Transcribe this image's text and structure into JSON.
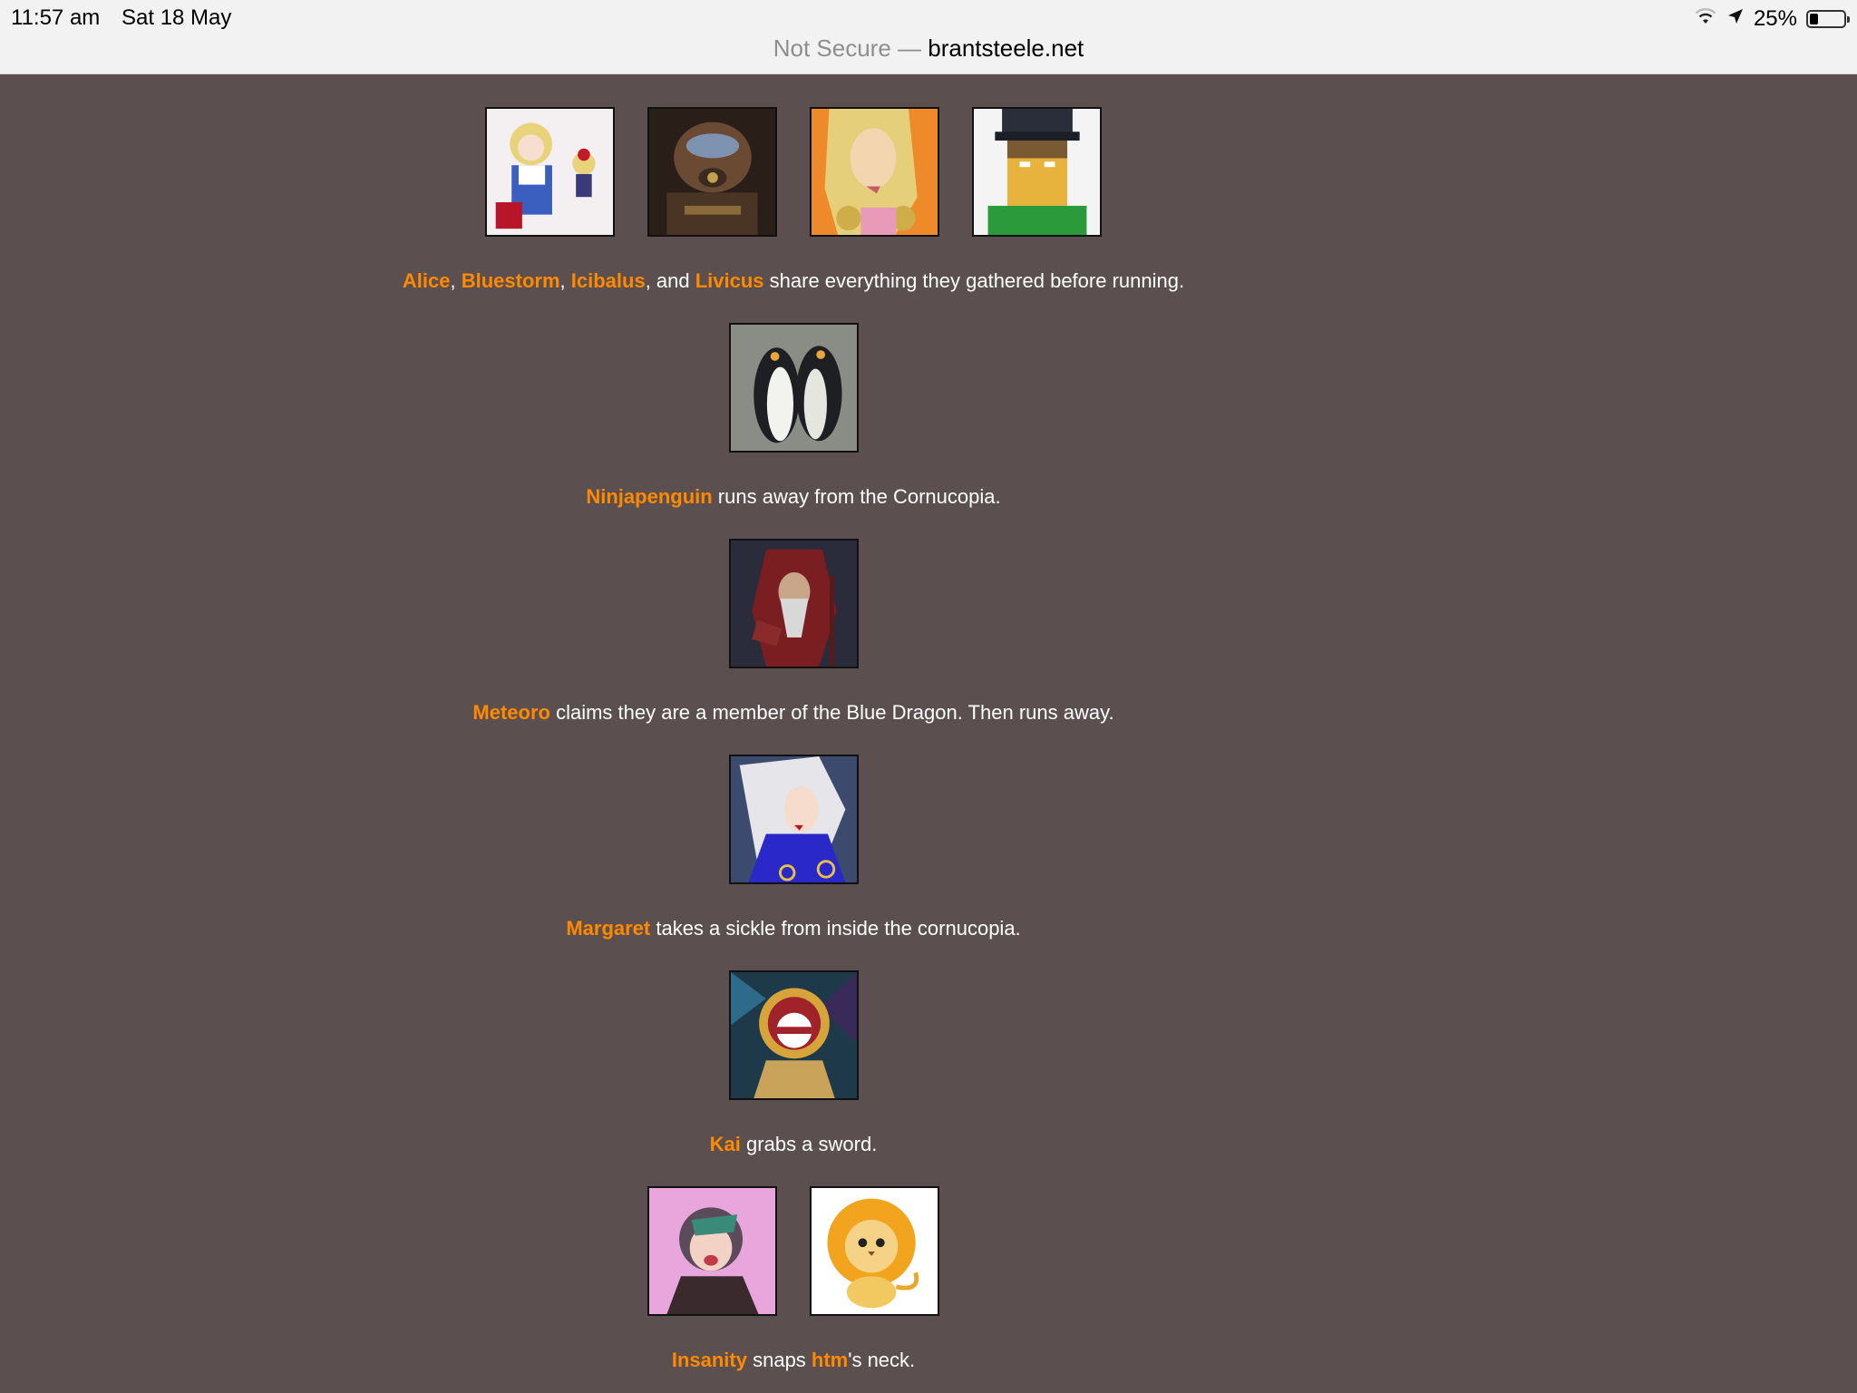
{
  "status_bar": {
    "time": "11:57 am",
    "date": "Sat 18 May",
    "battery_text": "25%",
    "battery_level": 0.25,
    "url_prefix": "Not Secure —",
    "url_host": "brantsteele.net"
  },
  "colors": {
    "background": "#5b4f50",
    "name_color": "#ff8a00",
    "text_color": "#ffffff"
  },
  "events": [
    {
      "tributes": [
        "Alice",
        "Bluestorm",
        "Icibalus",
        "Livicus"
      ],
      "segments": [
        {
          "text": "Alice",
          "name": true
        },
        {
          "text": ", ",
          "name": false
        },
        {
          "text": "Bluestorm",
          "name": true
        },
        {
          "text": ", ",
          "name": false
        },
        {
          "text": "Icibalus",
          "name": true
        },
        {
          "text": ", and ",
          "name": false
        },
        {
          "text": "Livicus",
          "name": true
        },
        {
          "text": " share everything they gathered before running.",
          "name": false
        }
      ]
    },
    {
      "tributes": [
        "Ninjapenguin"
      ],
      "segments": [
        {
          "text": "Ninjapenguin",
          "name": true
        },
        {
          "text": " runs away from the Cornucopia.",
          "name": false
        }
      ]
    },
    {
      "tributes": [
        "Meteoro"
      ],
      "segments": [
        {
          "text": "Meteoro",
          "name": true
        },
        {
          "text": " claims they are a member of the Blue Dragon. Then runs away.",
          "name": false
        }
      ]
    },
    {
      "tributes": [
        "Margaret"
      ],
      "segments": [
        {
          "text": "Margaret",
          "name": true
        },
        {
          "text": " takes a sickle from inside the cornucopia.",
          "name": false
        }
      ]
    },
    {
      "tributes": [
        "Kai"
      ],
      "segments": [
        {
          "text": "Kai",
          "name": true
        },
        {
          "text": " grabs a sword.",
          "name": false
        }
      ]
    },
    {
      "tributes": [
        "Insanity",
        "htm"
      ],
      "segments": [
        {
          "text": "Insanity",
          "name": true
        },
        {
          "text": " snaps ",
          "name": false
        },
        {
          "text": "htm",
          "name": true
        },
        {
          "text": "'s neck.",
          "name": false
        }
      ]
    }
  ]
}
